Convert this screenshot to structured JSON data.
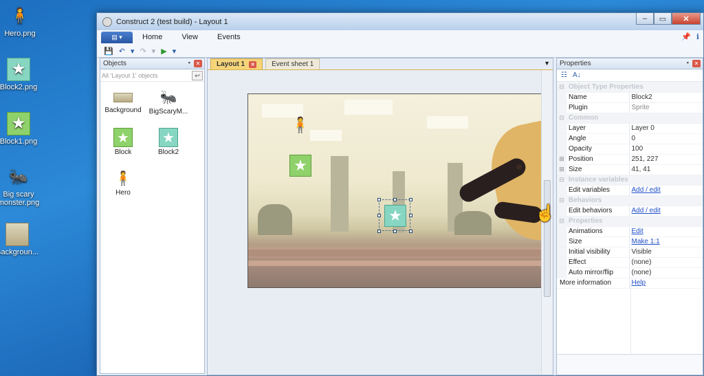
{
  "desktop": {
    "icons": [
      {
        "label": "Hero.png"
      },
      {
        "label": "Block2.png"
      },
      {
        "label": "Block1.png"
      },
      {
        "label": "Big scary monster.png"
      },
      {
        "label": "Backgroun..."
      }
    ]
  },
  "window": {
    "title": "Construct 2 (test build) - Layout 1",
    "controls": {
      "minimize": "‒",
      "maximize": "▭",
      "close": "✕"
    }
  },
  "ribbon": {
    "file_label": "▤ ▾",
    "menu": [
      "Home",
      "View",
      "Events"
    ],
    "quick_access": {
      "save": "💾",
      "undo": "↶",
      "undo_dd": "▾",
      "redo": "↷",
      "redo_dd": "▾",
      "run": "▶",
      "more": "▾"
    },
    "right_icons": {
      "pin": "📌",
      "help": "ℹ"
    }
  },
  "objects_panel": {
    "title": "Objects",
    "pin": "▪",
    "close": "✕",
    "filter": "All 'Layout 1' objects",
    "up": "↩",
    "items": [
      {
        "label": "Background",
        "kind": "bg"
      },
      {
        "label": "BigScaryM...",
        "kind": "monster"
      },
      {
        "label": "Block",
        "kind": "star"
      },
      {
        "label": "Block2",
        "kind": "star2"
      },
      {
        "label": "Hero",
        "kind": "hero"
      }
    ]
  },
  "editor": {
    "tabs": [
      {
        "label": "Layout 1",
        "active": true
      },
      {
        "label": "Event sheet 1",
        "active": false
      }
    ],
    "tab_close": "✕",
    "dropdown": "▼"
  },
  "properties": {
    "title": "Properties",
    "pin": "▪",
    "close": "✕",
    "tools": {
      "categorized": "☷",
      "alpha": "A↓"
    },
    "rows": [
      {
        "type": "cat",
        "label": "Object Type Properties"
      },
      {
        "type": "prop",
        "key": "Name",
        "value": "Block2"
      },
      {
        "type": "prop",
        "key": "Plugin",
        "value": "Sprite",
        "dim": true
      },
      {
        "type": "cat",
        "label": "Common"
      },
      {
        "type": "prop",
        "key": "Layer",
        "value": "Layer 0"
      },
      {
        "type": "prop",
        "key": "Angle",
        "value": "0"
      },
      {
        "type": "prop",
        "key": "Opacity",
        "value": "100"
      },
      {
        "type": "prop",
        "key": "Position",
        "value": "251, 227",
        "expand": true
      },
      {
        "type": "prop",
        "key": "Size",
        "value": "41, 41",
        "expand": true
      },
      {
        "type": "cat",
        "label": "Instance variables"
      },
      {
        "type": "prop",
        "key": "Edit variables",
        "value": "Add / edit",
        "link": true
      },
      {
        "type": "cat",
        "label": "Behaviors"
      },
      {
        "type": "prop",
        "key": "Edit behaviors",
        "value": "Add / edit",
        "link": true
      },
      {
        "type": "cat",
        "label": "Properties"
      },
      {
        "type": "prop",
        "key": "Animations",
        "value": "Edit",
        "link": true
      },
      {
        "type": "prop",
        "key": "Size",
        "value": "Make 1:1",
        "link": true
      },
      {
        "type": "prop",
        "key": "Initial visibility",
        "value": "Visible"
      },
      {
        "type": "prop",
        "key": "Effect",
        "value": "(none)"
      },
      {
        "type": "prop",
        "key": "Auto mirror/flip",
        "value": "(none)"
      },
      {
        "type": "top",
        "key": "More information",
        "value": "Help",
        "link": true
      }
    ]
  },
  "icons": {
    "star": "★",
    "hero": "🧍",
    "monster": "🐜",
    "cursor": "☝"
  },
  "colors": {
    "accent": "#2857a3",
    "tab_active": "#f6d57a",
    "link": "#1f4fc8"
  }
}
